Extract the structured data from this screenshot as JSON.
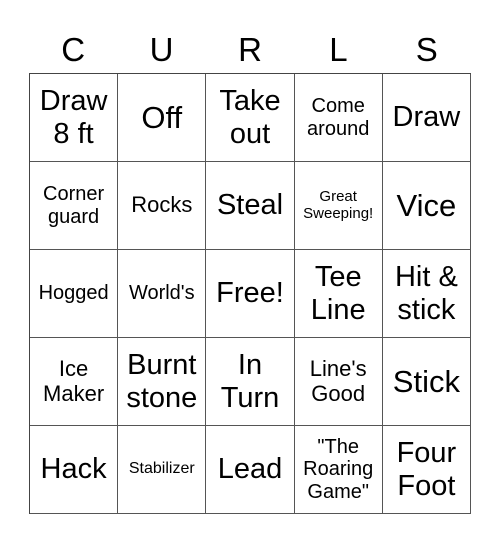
{
  "title_letters": [
    "C",
    "U",
    "R",
    "L",
    "S"
  ],
  "cells": [
    {
      "text": "Draw\n8 ft",
      "size": "l"
    },
    {
      "text": "Off",
      "size": "xl"
    },
    {
      "text": "Take\nout",
      "size": "l"
    },
    {
      "text": "Come\naround",
      "size": "s"
    },
    {
      "text": "Draw",
      "size": "l"
    },
    {
      "text": "Corner\nguard",
      "size": "s"
    },
    {
      "text": "Rocks",
      "size": "m"
    },
    {
      "text": "Steal",
      "size": "l"
    },
    {
      "text": "Great\nSweeping!",
      "size": "xs"
    },
    {
      "text": "Vice",
      "size": "xl"
    },
    {
      "text": "Hogged",
      "size": "s"
    },
    {
      "text": "World's",
      "size": "s"
    },
    {
      "text": "Free!",
      "size": "l"
    },
    {
      "text": "Tee\nLine",
      "size": "l"
    },
    {
      "text": "Hit &\nstick",
      "size": "l"
    },
    {
      "text": "Ice\nMaker",
      "size": "m"
    },
    {
      "text": "Burnt\nstone",
      "size": "l"
    },
    {
      "text": "In\nTurn",
      "size": "l"
    },
    {
      "text": "Line's\nGood",
      "size": "m"
    },
    {
      "text": "Stick",
      "size": "xl"
    },
    {
      "text": "Hack",
      "size": "l"
    },
    {
      "text": "Stabilizer",
      "size": "xxs"
    },
    {
      "text": "Lead",
      "size": "l"
    },
    {
      "text": "\"The\nRoaring\nGame\"",
      "size": "s"
    },
    {
      "text": "Four\nFoot",
      "size": "l"
    }
  ]
}
